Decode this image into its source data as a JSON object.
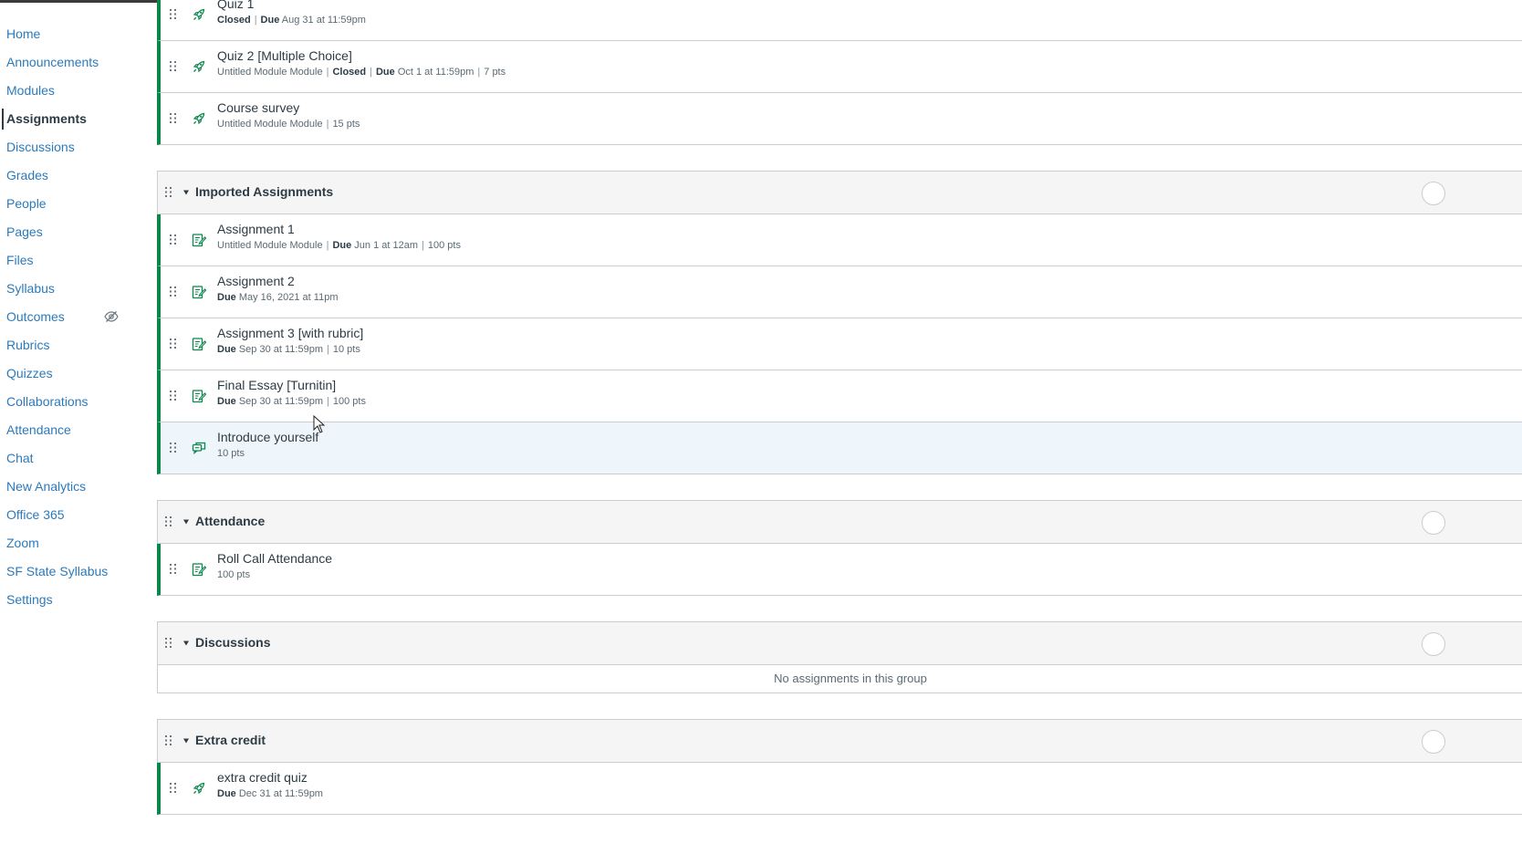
{
  "sidebar": {
    "items": [
      {
        "label": "Home"
      },
      {
        "label": "Announcements"
      },
      {
        "label": "Modules"
      },
      {
        "label": "Assignments",
        "active": true
      },
      {
        "label": "Discussions"
      },
      {
        "label": "Grades"
      },
      {
        "label": "People"
      },
      {
        "label": "Pages"
      },
      {
        "label": "Files"
      },
      {
        "label": "Syllabus"
      },
      {
        "label": "Outcomes",
        "icon": "eye-slash-icon"
      },
      {
        "label": "Rubrics"
      },
      {
        "label": "Quizzes"
      },
      {
        "label": "Collaborations"
      },
      {
        "label": "Attendance"
      },
      {
        "label": "Chat"
      },
      {
        "label": "New Analytics"
      },
      {
        "label": "Office 365"
      },
      {
        "label": "Zoom"
      },
      {
        "label": "SF State Syllabus"
      },
      {
        "label": "Settings"
      }
    ]
  },
  "colors": {
    "accent": "#0b874b",
    "link": "#2b7abc",
    "text": "#2d3b45",
    "hover_row": "#eef6fb"
  },
  "top_rows": [
    {
      "title": "Quiz 1",
      "icon": "rocket-icon",
      "module": "",
      "status": "Closed",
      "due_label": "Due",
      "due": "Aug 31 at 11:59pm",
      "pts": ""
    },
    {
      "title": "Quiz 2 [Multiple Choice]",
      "icon": "rocket-icon",
      "module": "Untitled Module Module",
      "status": "Closed",
      "due_label": "Due",
      "due": "Oct 1 at 11:59pm",
      "pts": "7 pts"
    },
    {
      "title": "Course survey",
      "icon": "rocket-icon",
      "module": "Untitled Module Module",
      "status": "",
      "due_label": "",
      "due": "",
      "pts": "15 pts"
    }
  ],
  "groups": [
    {
      "title": "Imported Assignments",
      "rows": [
        {
          "title": "Assignment 1",
          "icon": "assignment-icon",
          "module": "Untitled Module Module",
          "status": "",
          "due_label": "Due",
          "due": "Jun 1 at 12am",
          "pts": "100 pts"
        },
        {
          "title": "Assignment 2",
          "icon": "assignment-icon",
          "module": "",
          "status": "",
          "due_label": "Due",
          "due": "May 16, 2021 at 11pm",
          "pts": ""
        },
        {
          "title": "Assignment 3 [with rubric]",
          "icon": "assignment-icon",
          "module": "",
          "status": "",
          "due_label": "Due",
          "due": "Sep 30 at 11:59pm",
          "pts": "10 pts"
        },
        {
          "title": "Final Essay [Turnitin]",
          "icon": "assignment-icon",
          "module": "",
          "status": "",
          "due_label": "Due",
          "due": "Sep 30 at 11:59pm",
          "pts": "100 pts"
        },
        {
          "title": "Introduce yourself",
          "icon": "discussion-icon",
          "module": "",
          "status": "",
          "due_label": "",
          "due": "",
          "pts": "10 pts",
          "hover": true
        }
      ],
      "empty": ""
    },
    {
      "title": "Attendance",
      "rows": [
        {
          "title": "Roll Call Attendance",
          "icon": "assignment-icon",
          "module": "",
          "status": "",
          "due_label": "",
          "due": "",
          "pts": "100 pts"
        }
      ],
      "empty": ""
    },
    {
      "title": "Discussions",
      "rows": [],
      "empty": "No assignments in this group"
    },
    {
      "title": "Extra credit",
      "rows": [
        {
          "title": "extra credit quiz",
          "icon": "rocket-icon",
          "module": "",
          "status": "",
          "due_label": "Due",
          "due": "Dec 31 at 11:59pm",
          "pts": ""
        }
      ],
      "empty": ""
    }
  ]
}
